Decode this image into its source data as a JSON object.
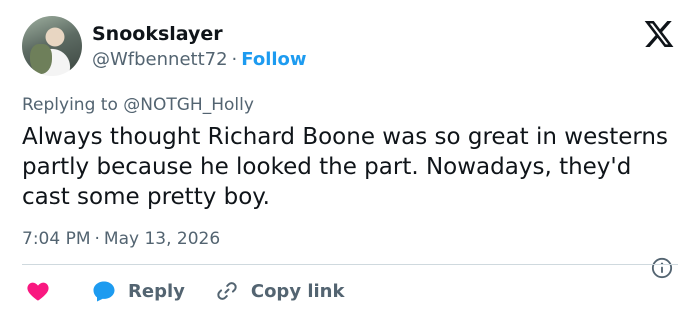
{
  "author": {
    "display_name": "Snookslayer",
    "handle": "@Wfbennett72",
    "separator": "·",
    "follow_label": "Follow"
  },
  "reply_context": {
    "prefix": "Replying to",
    "target": "@NOTGH_Holly"
  },
  "tweet": {
    "text": "Always thought Richard Boone was so great in westerns partly because he looked the part. Nowadays, they'd cast some pretty boy."
  },
  "meta": {
    "time": "7:04 PM",
    "separator": "·",
    "date": "May 13, 2026"
  },
  "actions": {
    "reply_label": "Reply",
    "copy_link_label": "Copy link"
  },
  "icons": {
    "logo": "x-logo-icon",
    "info": "info-icon",
    "like": "heart-icon",
    "reply": "speech-bubble-icon",
    "copy": "link-chain-icon"
  },
  "colors": {
    "text": "#0f1419",
    "secondary": "#536471",
    "accent": "#1d9bf0",
    "heart": "#f91880",
    "divider": "#cfd9de"
  }
}
